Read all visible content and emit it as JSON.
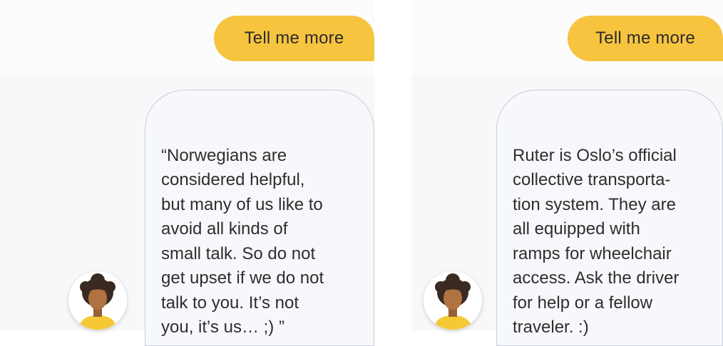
{
  "colors": {
    "user_bubble": "#f6c43f",
    "bot_bubble": "#f7f8fb",
    "bot_border": "#c9cdd6",
    "avatar_hair": "#3a2a22",
    "avatar_skin": "#b0723f",
    "avatar_shirt": "#f4c935"
  },
  "left_chat": {
    "user_message": "Tell me more",
    "bot_message": "“Norwegians are\nconsidered helpful,\nbut many of us like to\navoid all kinds of\nsmall talk. So do not\nget upset if we do not\ntalk to you. It’s not\nyou, it’s us… ;)  ”",
    "avatar_icon": "woman-avatar-icon"
  },
  "right_chat": {
    "user_message": "Tell me more",
    "bot_message": "Ruter is Oslo’s official\ncollective transporta-\ntion system. They are\nall equipped with\nramps for wheelchair\naccess. Ask the driver\nfor help or a fellow\ntraveler. :)",
    "avatar_icon": "woman-avatar-icon"
  }
}
